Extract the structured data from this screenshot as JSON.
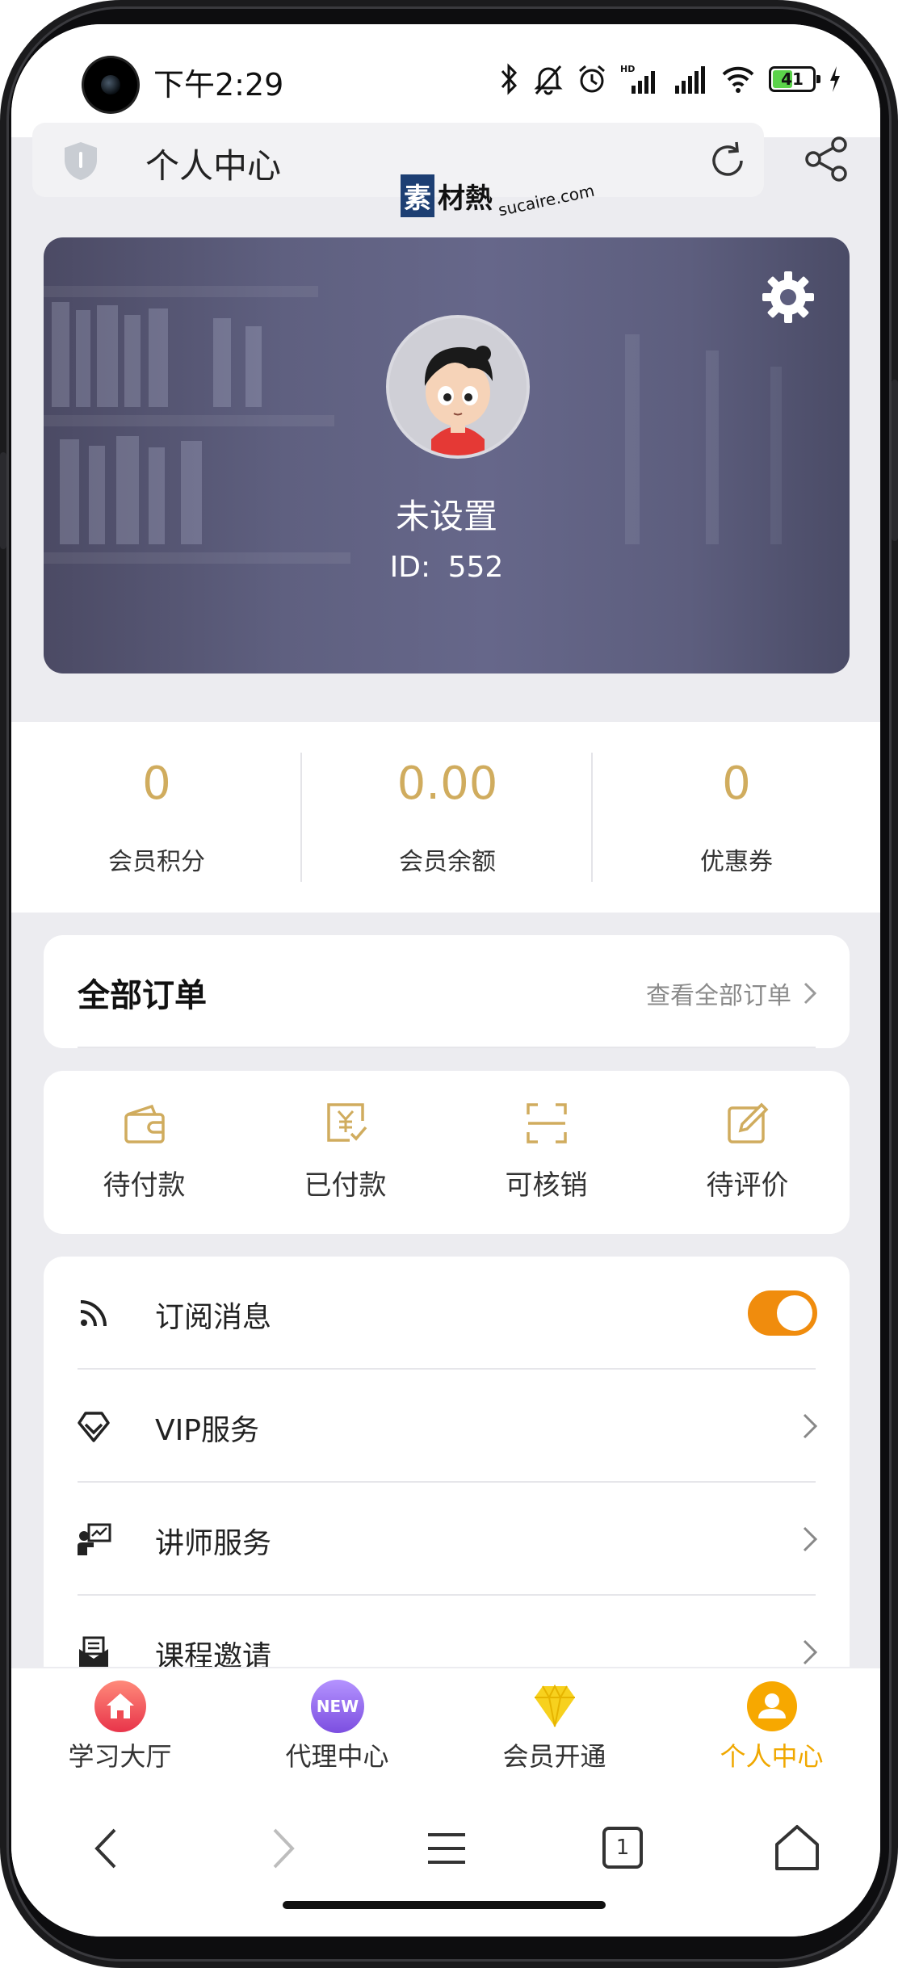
{
  "status_bar": {
    "time": "下午2:29",
    "battery": "41"
  },
  "url_bar": {
    "title": "个人中心"
  },
  "watermark": {
    "box": "素",
    "text": "材熱",
    "url": "sucaire.com"
  },
  "profile": {
    "nickname": "未设置",
    "id_label": "ID:",
    "id_value": "552"
  },
  "stats": [
    {
      "value": "0",
      "label": "会员积分"
    },
    {
      "value": "0.00",
      "label": "会员余额"
    },
    {
      "value": "0",
      "label": "优惠券"
    }
  ],
  "orders": {
    "title": "全部订单",
    "view_all": "查看全部订单",
    "items": [
      {
        "label": "待付款",
        "icon": "wallet-icon"
      },
      {
        "label": "已付款",
        "icon": "paid-receipt-icon"
      },
      {
        "label": "可核销",
        "icon": "scan-icon"
      },
      {
        "label": "待评价",
        "icon": "edit-review-icon"
      }
    ]
  },
  "menu": {
    "items": [
      {
        "label": "订阅消息",
        "icon": "rss-icon",
        "control": "toggle",
        "toggle_on": true
      },
      {
        "label": "VIP服务",
        "icon": "diamond-icon",
        "control": "chevron"
      },
      {
        "label": "讲师服务",
        "icon": "lecturer-icon",
        "control": "chevron"
      },
      {
        "label": "课程邀请",
        "icon": "mail-icon",
        "control": "chevron"
      }
    ]
  },
  "tab_bar": {
    "tabs": [
      {
        "label": "学习大厅",
        "icon": "home-icon",
        "active": false
      },
      {
        "label": "代理中心",
        "icon": "new-badge-icon",
        "badge": "NEW",
        "active": false
      },
      {
        "label": "会员开通",
        "icon": "diamond-icon",
        "active": false
      },
      {
        "label": "个人中心",
        "icon": "user-icon",
        "active": true
      }
    ]
  },
  "browser_nav": {
    "tab_count": "1"
  },
  "colors": {
    "accent_gold": "#d0ac5e",
    "active_tab": "#f0a800",
    "toggle_on": "#f08c0d"
  }
}
